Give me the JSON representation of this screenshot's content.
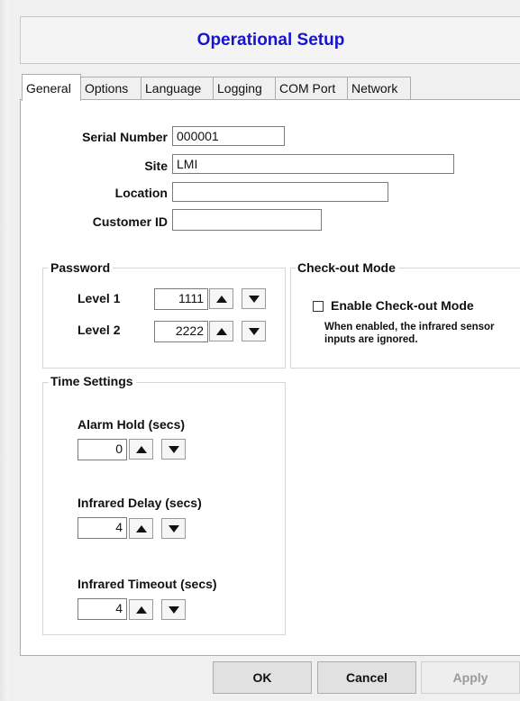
{
  "window": {
    "title": "Operational Setup"
  },
  "tabs": [
    "General",
    "Options",
    "Language",
    "Logging",
    "COM Port",
    "Network"
  ],
  "general": {
    "serial_number_label": "Serial Number",
    "serial_number_value": "000001",
    "site_label": "Site",
    "site_value": "LMI",
    "location_label": "Location",
    "location_value": "",
    "customer_id_label": "Customer ID",
    "customer_id_value": ""
  },
  "password": {
    "title": "Password",
    "level1_label": "Level 1",
    "level1_value": "1111",
    "level2_label": "Level 2",
    "level2_value": "2222"
  },
  "checkout": {
    "title": "Check-out Mode",
    "checkbox_label": "Enable Check-out Mode",
    "checked": false,
    "note_line1": "When enabled, the infrared sensor",
    "note_line2": "inputs are ignored."
  },
  "time_settings": {
    "title": "Time Settings",
    "alarm_hold_label": "Alarm Hold (secs)",
    "alarm_hold_value": "0",
    "infrared_delay_label": "Infrared Delay (secs)",
    "infrared_delay_value": "4",
    "infrared_timeout_label": "Infrared Timeout (secs)",
    "infrared_timeout_value": "4"
  },
  "buttons": {
    "ok": "OK",
    "cancel": "Cancel",
    "apply": "Apply"
  },
  "colors": {
    "title": "#1515d0",
    "panel": "#ffffff",
    "dialog": "#f0f0f0"
  }
}
